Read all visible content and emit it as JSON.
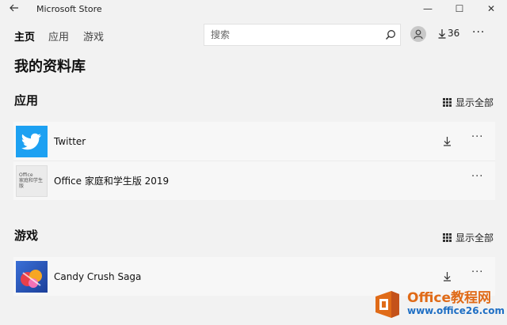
{
  "window": {
    "title": "Microsoft Store",
    "controls": {
      "minimize": "—",
      "maximize": "☐",
      "close": "✕"
    }
  },
  "nav": {
    "tabs": [
      {
        "label": "主页",
        "active": true
      },
      {
        "label": "应用",
        "active": false
      },
      {
        "label": "游戏",
        "active": false
      }
    ],
    "search_placeholder": "搜索",
    "downloads_count": "36",
    "more_label": "···"
  },
  "page": {
    "title": "我的资料库"
  },
  "sections": [
    {
      "heading": "应用",
      "show_all_label": "显示全部",
      "items": [
        {
          "name": "Twitter",
          "icon": "twitter-icon",
          "downloadable": true,
          "more": "···"
        },
        {
          "name": "Office 家庭和学生版 2019",
          "icon": "office-icon",
          "downloadable": false,
          "more": "···",
          "tile_text_1": "Office",
          "tile_text_2": "家庭和学生版"
        }
      ]
    },
    {
      "heading": "游戏",
      "show_all_label": "显示全部",
      "items": [
        {
          "name": "Candy Crush Saga",
          "icon": "candy-crush-icon",
          "downloadable": true,
          "more": "···"
        }
      ]
    }
  ],
  "watermark": {
    "main": "Office教程网",
    "sub": "www.office26.com"
  },
  "colors": {
    "background": "#f2f2f2",
    "twitter_blue": "#1da1f2",
    "watermark_orange": "#e06b18",
    "watermark_blue": "#1f6fc4"
  }
}
